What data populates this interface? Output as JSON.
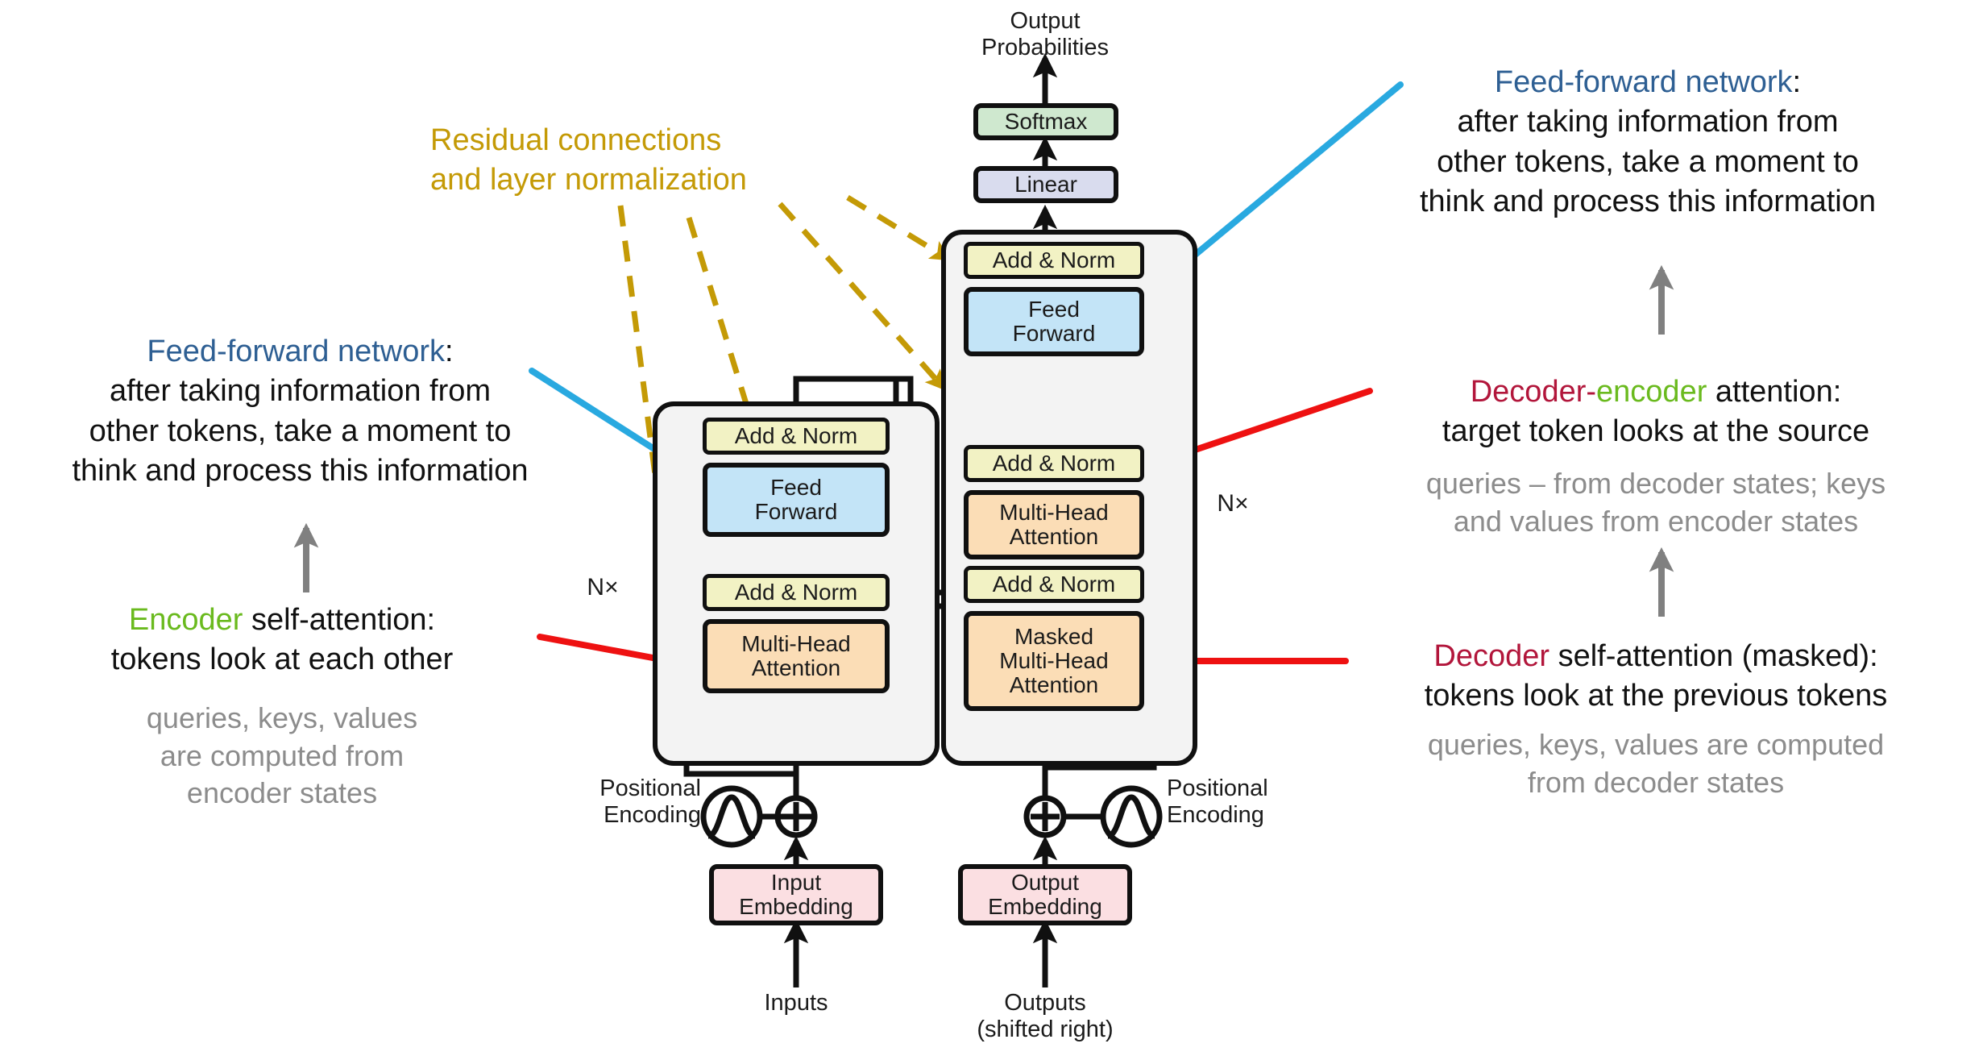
{
  "figure": {
    "title": "The Transformer — model architecture with annotations",
    "colors": {
      "add_norm_fill": "#f2f2c4",
      "feed_forward_fill": "#c3e4f7",
      "attention_fill": "#fbddb6",
      "softmax_fill": "#cfe8cf",
      "linear_fill": "#d9dcee",
      "embedding_fill": "#fbdfe2",
      "stack_panel_fill": "#f3f3f3",
      "outline": "#101010",
      "blue_annotation": "#2e5f93",
      "blue_arrow": "#29a9e0",
      "green_highlight": "#6aba1e",
      "crimson_highlight": "#b2163b",
      "red_arrow": "#ee1111",
      "gold_dashed": "#c49a06",
      "gray_arrow": "#808080",
      "gray_subtext": "#8c8c8c"
    }
  },
  "diagram": {
    "output_probabilities_label": "Output\nProbabilities",
    "softmax_label": "Softmax",
    "linear_label": "Linear",
    "encoder": {
      "add_norm_top_label": "Add & Norm",
      "feed_forward_label": "Feed\nForward",
      "add_norm_bottom_label": "Add & Norm",
      "multi_head_attention_label": "Multi-Head\nAttention",
      "repeat_label": "N×",
      "positional_encoding_label": "Positional\nEncoding",
      "embedding_label": "Input\nEmbedding",
      "io_label": "Inputs"
    },
    "decoder": {
      "add_norm_top_label": "Add & Norm",
      "feed_forward_label": "Feed\nForward",
      "add_norm_mid_label": "Add & Norm",
      "multi_head_attention_label": "Multi-Head\nAttention",
      "add_norm_bottom_label": "Add & Norm",
      "masked_attention_label": "Masked\nMulti-Head\nAttention",
      "repeat_label": "N×",
      "positional_encoding_label": "Positional\nEncoding",
      "embedding_label": "Output\nEmbedding",
      "io_label": "Outputs\n(shifted right)"
    }
  },
  "annotations": {
    "residual": {
      "line1": "Residual connections",
      "line2": "and layer normalization",
      "color": "#c49a06"
    },
    "ffn_left": {
      "title_colored": "Feed-forward network",
      "title_tail": ":",
      "body_lines": [
        "after taking information from",
        "other tokens, take a moment to",
        "think and process this information"
      ]
    },
    "ffn_right": {
      "title_colored": "Feed-forward network",
      "title_tail": ":",
      "body_lines": [
        "after taking information from",
        "other tokens, take a moment to",
        "think and process this information"
      ]
    },
    "encoder_self_attention": {
      "title_colored": "Encoder",
      "title_tail": " self-attention:",
      "body_lines": [
        "tokens look at each other"
      ],
      "sub_lines": [
        "queries, keys, values",
        "are computed from",
        "encoder states"
      ]
    },
    "decoder_encoder_attention": {
      "title_part1": "Decoder",
      "title_dash": "-",
      "title_part2": "encoder",
      "title_tail": " attention:",
      "body_lines": [
        "target token looks at the source"
      ],
      "sub_lines": [
        "queries – from decoder states; keys",
        "and values from encoder states"
      ]
    },
    "decoder_self_attention": {
      "title_colored": "Decoder",
      "title_tail": " self-attention (masked):",
      "body_lines": [
        "tokens look at the previous tokens"
      ],
      "sub_lines": [
        "queries, keys, values are computed",
        "from decoder states"
      ]
    }
  }
}
